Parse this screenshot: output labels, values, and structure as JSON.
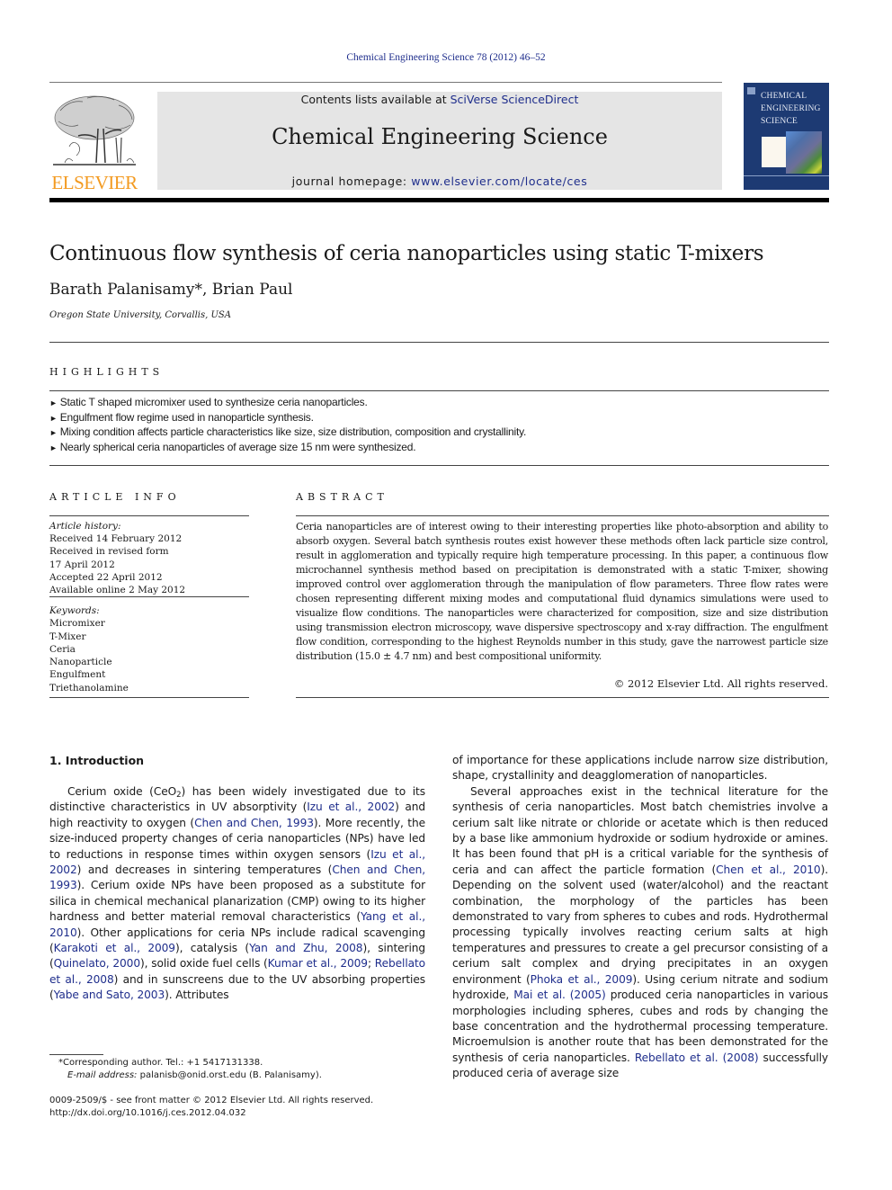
{
  "running_head": "Chemical Engineering Science 78 (2012) 46–52",
  "publisher": {
    "logo_wordmark": "ELSEVIER",
    "logo_icon": "elsevier-tree-icon"
  },
  "journal_banner": {
    "contents_prefix": "Contents lists available at ",
    "contents_link": "SciVerse ScienceDirect",
    "journal_title": "Chemical Engineering Science",
    "homepage_prefix": "journal homepage: ",
    "homepage_link": "www.elsevier.com/locate/ces"
  },
  "cover": {
    "title_lines": [
      "CHEMICAL",
      "ENGINEERING",
      "SCIENCE"
    ],
    "color": "#1d3a73"
  },
  "colors": {
    "link": "#1f2e8c",
    "elsevier_orange": "#f39a20",
    "banner_bg": "#e5e5e5"
  },
  "article": {
    "title": "Continuous flow synthesis of ceria nanoparticles using static T-mixers",
    "authors": "Barath Palanisamy",
    "author_mark": "*",
    "authors_rest": ", Brian Paul",
    "affiliation": "Oregon State University, Corvallis, USA"
  },
  "highlights": {
    "label": "HIGHLIGHTS",
    "bullet": "►",
    "items": [
      "Static T shaped micromixer used to synthesize ceria nanoparticles.",
      "Engulfment flow regime used in nanoparticle synthesis.",
      "Mixing condition affects particle characteristics like size, size distribution, composition and crystallinity.",
      "Nearly spherical ceria nanoparticles of average size 15 nm were synthesized."
    ]
  },
  "article_info": {
    "label": "ARTICLE INFO",
    "history_label": "Article history:",
    "history": [
      "Received 14 February 2012",
      "Received in revised form",
      "17 April 2012",
      "Accepted 22 April 2012",
      "Available online 2 May 2012"
    ],
    "keywords_label": "Keywords:",
    "keywords": [
      "Micromixer",
      "T-Mixer",
      "Ceria",
      "Nanoparticle",
      "Engulfment",
      "Triethanolamine"
    ]
  },
  "abstract": {
    "label": "ABSTRACT",
    "text": "Ceria nanoparticles are of interest owing to their interesting properties like photo-absorption and ability to absorb oxygen. Several batch synthesis routes exist however these methods often lack particle size control, result in agglomeration and typically require high temperature processing. In this paper, a continuous flow microchannel synthesis method based on precipitation is demonstrated with a static T-mixer, showing improved control over agglomeration through the manipulation of flow parameters. Three flow rates were chosen representing different mixing modes and computational fluid dynamics simulations were used to visualize flow conditions. The nanoparticles were characterized for composition, size and size distribution using transmission electron microscopy, wave dispersive spectroscopy and x-ray diffraction. The engulfment flow condition, corresponding to the highest Reynolds number in this study, gave the narrowest particle size distribution (15.0 ± 4.7 nm) and best compositional uniformity.",
    "copyright": "© 2012 Elsevier Ltd. All rights reserved."
  },
  "introduction": {
    "heading": "1.  Introduction",
    "left_segments": [
      {
        "t": "Cerium oxide (CeO"
      },
      {
        "sub": "2"
      },
      {
        "t": ") has been widely investigated due to its distinctive characteristics in UV absorptivity ("
      },
      {
        "c": "Izu et al., 2002"
      },
      {
        "t": ") and high reactivity to oxygen ("
      },
      {
        "c": "Chen and Chen, 1993"
      },
      {
        "t": "). More recently, the size-induced property changes of ceria nanoparticles (NPs) have led to reductions in response times within oxygen sensors ("
      },
      {
        "c": "Izu et al., 2002"
      },
      {
        "t": ") and decreases in sintering temperatures ("
      },
      {
        "c": "Chen and Chen, 1993"
      },
      {
        "t": "). Cerium oxide NPs have been proposed as a substitute for silica in chemical mechanical planarization (CMP) owing to its higher hardness and better material removal characteristics ("
      },
      {
        "c": "Yang et al., 2010"
      },
      {
        "t": "). Other applications for ceria NPs include radical scavenging ("
      },
      {
        "c": "Karakoti et al., 2009"
      },
      {
        "t": "), catalysis ("
      },
      {
        "c": "Yan and Zhu, 2008"
      },
      {
        "t": "), sintering ("
      },
      {
        "c": "Quinelato, 2000"
      },
      {
        "t": "), solid oxide fuel cells ("
      },
      {
        "c": "Kumar et al., 2009"
      },
      {
        "t": "; "
      },
      {
        "c": "Rebellato et al., 2008"
      },
      {
        "t": ") and in sunscreens due to the UV absorbing properties ("
      },
      {
        "c": "Yabe and Sato, 2003"
      },
      {
        "t": "). Attributes"
      }
    ],
    "right_p1": [
      {
        "t": "of importance for these applications include narrow size distribution, shape, crystallinity and deagglomeration of nanoparticles."
      }
    ],
    "right_p2": [
      {
        "t": "Several approaches exist in the technical literature for the synthesis of ceria nanoparticles. Most batch chemistries involve a cerium salt like nitrate or chloride or acetate which is then reduced by a base like ammonium hydroxide or sodium hydroxide or amines. It has been found that pH is a critical variable for the synthesis of ceria and can affect the particle formation ("
      },
      {
        "c": "Chen et al., 2010"
      },
      {
        "t": "). Depending on the solvent used (water/alcohol) and the reactant combination, the morphology of the particles has been demonstrated to vary from spheres to cubes and rods. Hydrothermal processing typically involves reacting cerium salts at high temperatures and pressures to create a gel precursor consisting of a cerium salt complex and drying precipitates in an oxygen environment ("
      },
      {
        "c": "Phoka et al., 2009"
      },
      {
        "t": "). Using cerium nitrate and sodium hydroxide, "
      },
      {
        "c": "Mai et al. (2005)"
      },
      {
        "t": " produced ceria nanoparticles in various morphologies including spheres, cubes and rods by changing the base concentration and the hydrothermal processing temperature. Microemulsion is another route that has been demonstrated for the synthesis of ceria nanoparticles. "
      },
      {
        "c": "Rebellato et al. (2008)"
      },
      {
        "t": " successfully produced ceria of average size"
      }
    ]
  },
  "footnote": {
    "mark": "*",
    "corresponding": "Corresponding author. Tel.: +1 5417131338.",
    "email_label": "E-mail address:",
    "email": " palanisb@onid.orst.edu (B. Palanisamy)."
  },
  "front_matter": {
    "issn_line": "0009-2509/$ - see front matter © 2012 Elsevier Ltd. All rights reserved.",
    "doi": "http://dx.doi.org/10.1016/j.ces.2012.04.032"
  }
}
